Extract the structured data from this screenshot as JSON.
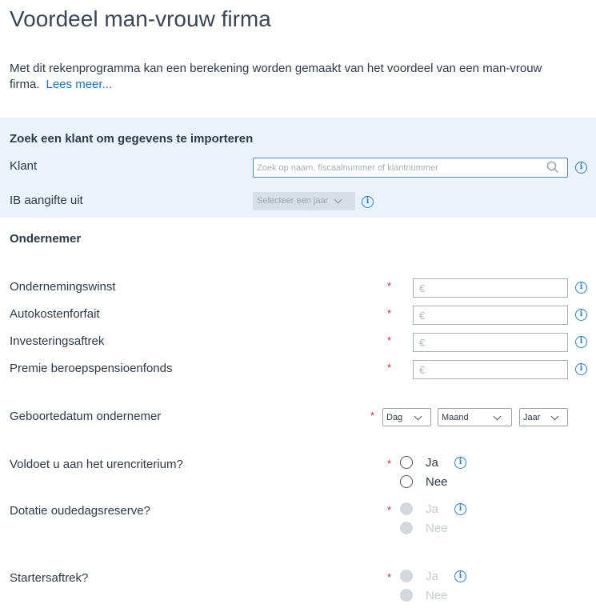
{
  "page": {
    "title": "Voordeel man-vrouw firma",
    "intro": "Met dit rekenprogramma kan een berekening worden gemaakt van het voordeel van een man-vrouw firma.",
    "read_more": "Lees meer..."
  },
  "import": {
    "heading": "Zoek een klant om gegevens te importeren",
    "client_label": "Klant",
    "search_placeholder": "Zoek op naam, fiscaalnummer of klantnummer",
    "ib_label": "IB aangifte uit",
    "year_select": "Selecteer een jaar"
  },
  "entrepreneur": {
    "heading": "Ondernemer",
    "required_mark": "*",
    "currency_symbol": "€",
    "fields": [
      {
        "label": "Ondernemingswinst"
      },
      {
        "label": "Autokostenforfait"
      },
      {
        "label": "Investeringsaftrek"
      },
      {
        "label": "Premie beroepspensioenfonds"
      }
    ],
    "birthdate": {
      "label": "Geboortedatum ondernemer",
      "day": "Dag",
      "month": "Maand",
      "year": "Jaar"
    },
    "questions": [
      {
        "label": "Voldoet u aan het urencriterium?",
        "yes": "Ja",
        "no": "Nee",
        "disabled": false
      },
      {
        "label": "Dotatie oudedagsreserve?",
        "yes": "Ja",
        "no": "Nee",
        "disabled": true
      },
      {
        "label": "Startersaftrek?",
        "yes": "Ja",
        "no": "Nee",
        "disabled": true
      }
    ]
  },
  "colors": {
    "accent": "#2f7fc6",
    "panel_bg": "#eaf2fa",
    "required": "#d9272e"
  }
}
